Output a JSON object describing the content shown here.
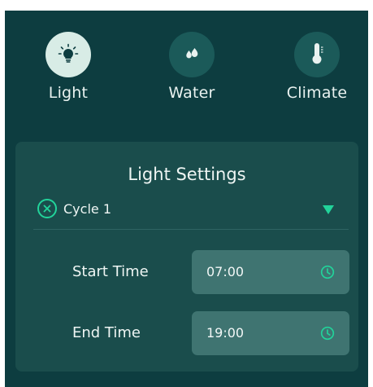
{
  "tabs": [
    {
      "label": "Light",
      "icon": "lightbulb-icon",
      "active": true
    },
    {
      "label": "Water",
      "icon": "water-drops-icon",
      "active": false
    },
    {
      "label": "Climate",
      "icon": "thermometer-icon",
      "active": false
    }
  ],
  "settings": {
    "title": "Light Settings",
    "cycle": {
      "label": "Cycle 1",
      "icon": "close-circle-icon"
    },
    "start_time": {
      "label": "Start Time",
      "value": "07:00",
      "icon": "clock-icon"
    },
    "end_time": {
      "label": "End Time",
      "value": "19:00",
      "icon": "clock-icon"
    }
  },
  "colors": {
    "background": "#0d3d40",
    "card": "#1a4d4c",
    "input": "#3f7471",
    "accent": "#22d39a",
    "active_tab": "#d8ece6"
  }
}
